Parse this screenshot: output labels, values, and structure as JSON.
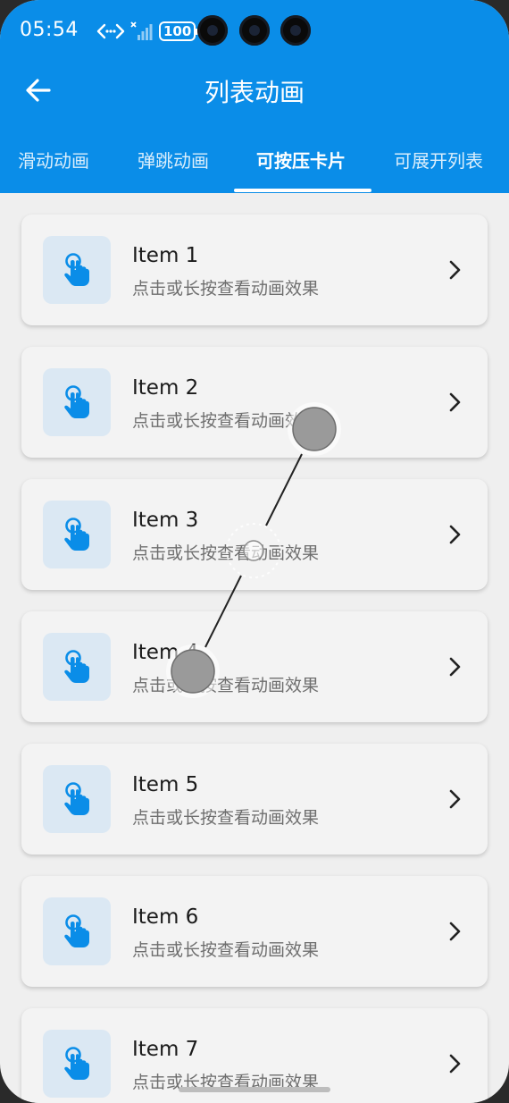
{
  "status_bar": {
    "time": "05:54",
    "battery": "100",
    "icons": [
      "code-arrows-icon",
      "signal-icon",
      "battery-icon"
    ]
  },
  "header": {
    "title": "列表动画",
    "back_icon": "arrow-left-icon"
  },
  "tabs": [
    {
      "label": "滑动动画",
      "active": false
    },
    {
      "label": "弹跳动画",
      "active": false
    },
    {
      "label": "可按压卡片",
      "active": true
    },
    {
      "label": "可展开列表",
      "active": false
    }
  ],
  "items": [
    {
      "title": "Item 1",
      "subtitle": "点击或长按查看动画效果"
    },
    {
      "title": "Item 2",
      "subtitle": "点击或长按查看动画效果"
    },
    {
      "title": "Item 3",
      "subtitle": "点击或长按查看动画效果"
    },
    {
      "title": "Item 4",
      "subtitle": "点击或长按查看动画效果"
    },
    {
      "title": "Item 5",
      "subtitle": "点击或长按查看动画效果"
    },
    {
      "title": "Item 6",
      "subtitle": "点击或长按查看动画效果"
    },
    {
      "title": "Item 7",
      "subtitle": "点击或长按查看动画效果"
    }
  ],
  "colors": {
    "primary": "#0a8de8",
    "background": "#efefef",
    "card": "#f3f3f3",
    "icon_box": "#dbe8f3",
    "icon": "#0a8de8"
  }
}
